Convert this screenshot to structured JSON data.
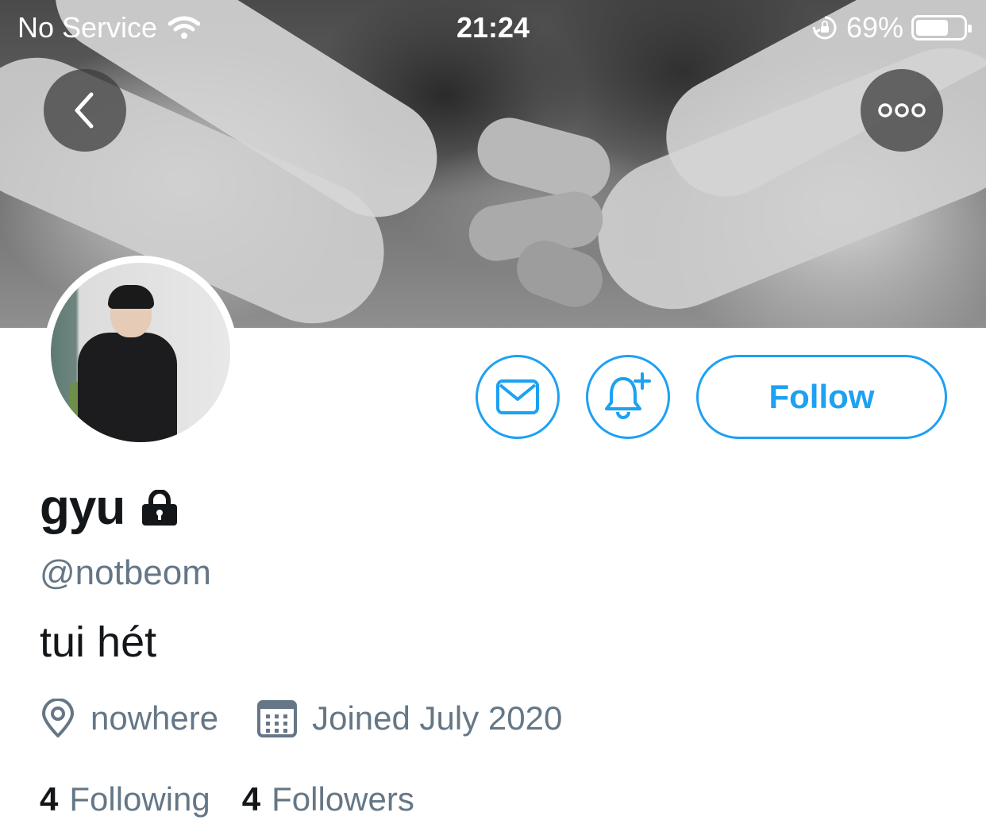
{
  "status_bar": {
    "carrier": "No Service",
    "time": "21:24",
    "battery": "69%",
    "battery_level": 0.69,
    "wifi_icon": "wifi-icon",
    "rotation_lock_icon": "rotation-lock-icon"
  },
  "nav": {
    "back_icon": "chevron-left-icon",
    "more_icon": "more-horizontal-icon"
  },
  "profile": {
    "display_name": "gyu",
    "protected_icon": "lock-icon",
    "handle": "@notbeom",
    "bio": "tui hét",
    "location": "nowhere",
    "joined": "Joined July 2020",
    "following_count": "4",
    "following_label": "Following",
    "followers_count": "4",
    "followers_label": "Followers"
  },
  "actions": {
    "message_icon": "envelope-icon",
    "notify_icon": "bell-plus-icon",
    "follow_label": "Follow"
  },
  "colors": {
    "accent": "#1da1f2",
    "text_primary": "#14171a",
    "text_secondary": "#657786"
  }
}
